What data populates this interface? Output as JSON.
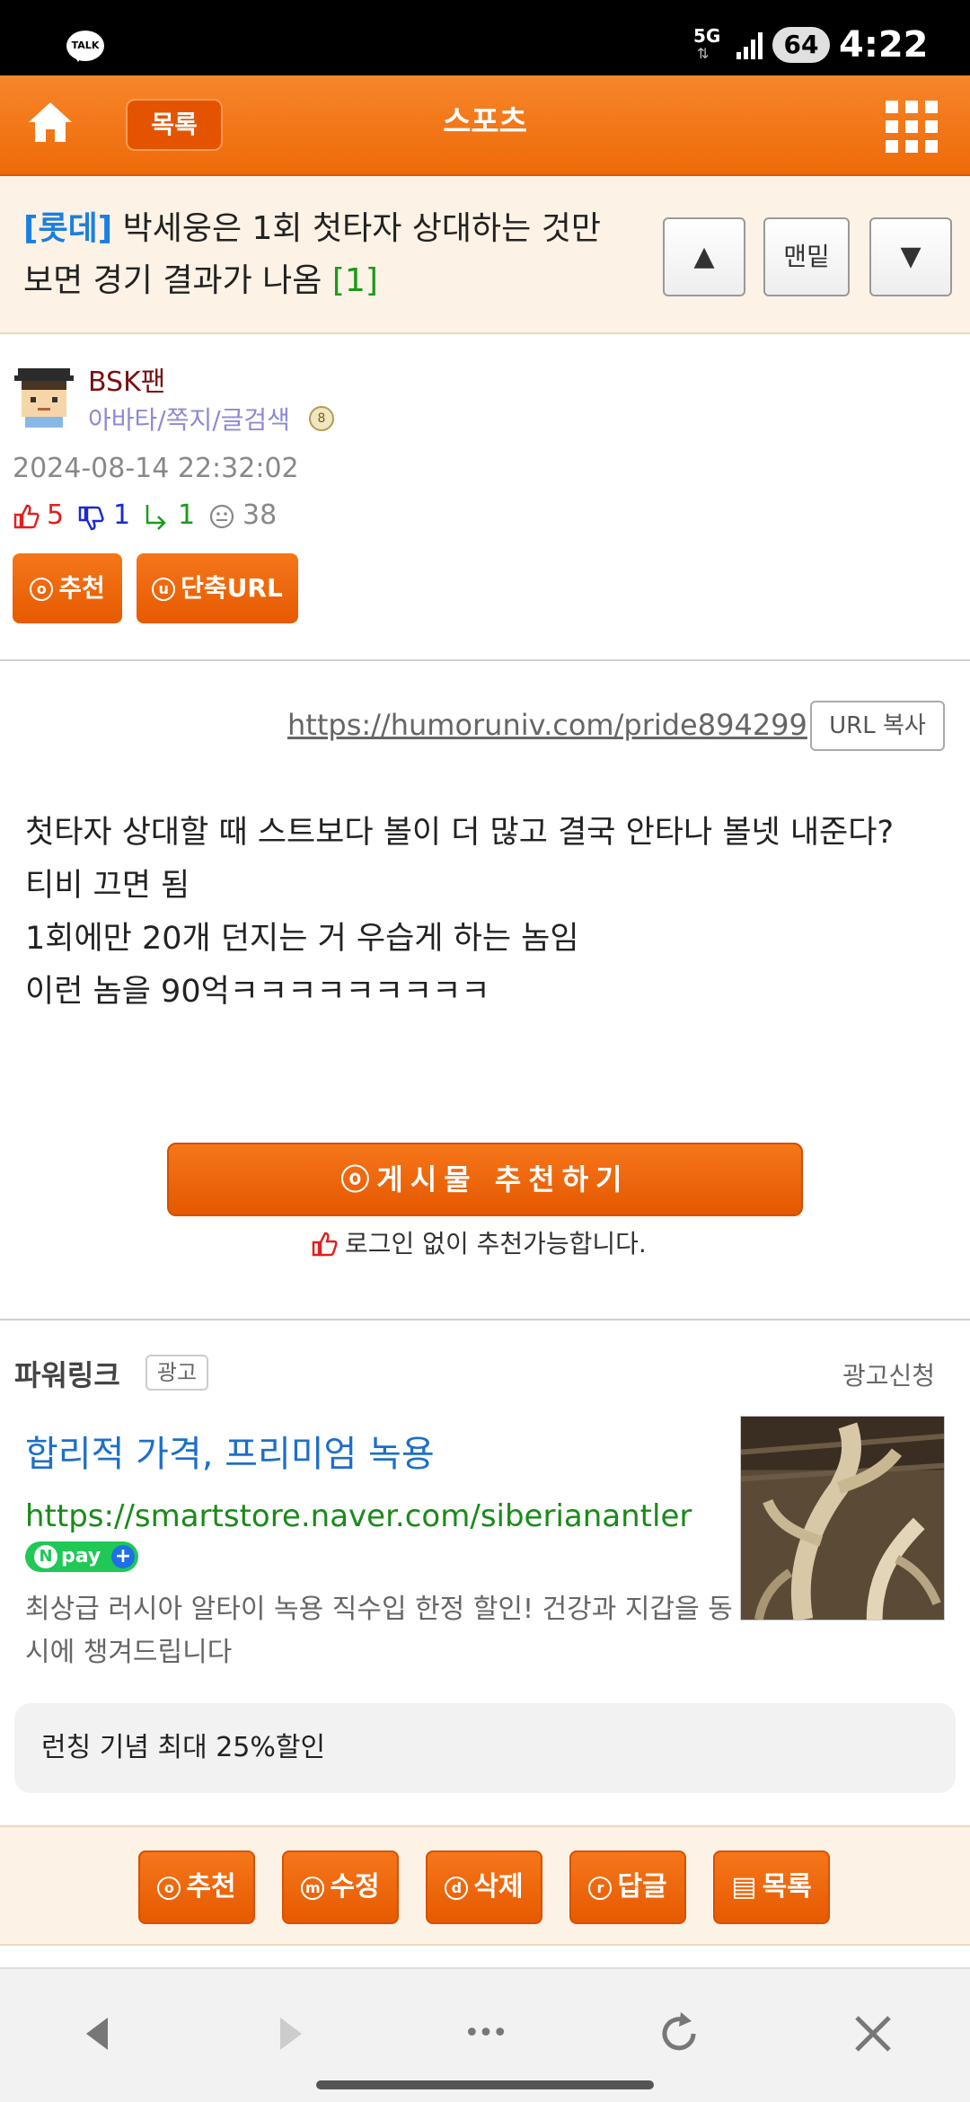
{
  "status_bar": {
    "time": "4:22",
    "battery": "64",
    "network": "5G",
    "talk_icon_label": "TALK"
  },
  "header": {
    "list_label": "목록",
    "title": "스포츠"
  },
  "post": {
    "category": "[롯데]",
    "title": "박세웅은 1회 첫타자 상대하는 것만 보면 경기 결과가 나옴",
    "comment_count": "[1]",
    "nav_up": "▲",
    "nav_bottom": "맨밑",
    "nav_down": "▼"
  },
  "author": {
    "name": "BSK팬",
    "links": "아바타/쪽지/글검색",
    "date": "2024-08-14 22:32:02"
  },
  "stats": {
    "likes": "5",
    "dislikes": "1",
    "replies": "1",
    "views": "38"
  },
  "actions": {
    "recommend_icon": "ⓞ",
    "recommend": "추천",
    "short_url_icon": "ⓤ",
    "short_url": "단축URL"
  },
  "body": {
    "source_url": "https://humoruniv.com/pride894299",
    "url_copy": "URL 복사",
    "lines": [
      "첫타자 상대할 때 스트보다 볼이 더 많고 결국 안타나 볼넷 내준다?",
      "티비 끄면 됨",
      "1회에만 20개 던지는 거 우습게 하는 놈임",
      "이런 놈을 90억ㅋㅋㅋㅋㅋㅋㅋㅋㅋ"
    ],
    "recommend_button": "ⓞ게시물 추천하기",
    "login_note": "로그인 없이 추천가능합니다."
  },
  "ad": {
    "label": "파워링크",
    "badge": "광고",
    "apply": "광고신청",
    "title": "합리적 가격, 프리미엄 녹용",
    "url": "https://smartstore.naver.com/siberianantler",
    "npay": "pay",
    "description": "최상급 러시아 알타이 녹용 직수입 한정 할인! 건강과 지갑을 동시에 챙겨드립니다",
    "promo": "런칭 기념 최대 25%할인"
  },
  "bottom_actions": [
    {
      "icon": "ⓞ",
      "label": "추천"
    },
    {
      "icon": "ⓜ",
      "label": "수정"
    },
    {
      "icon": "ⓓ",
      "label": "삭제"
    },
    {
      "icon": "ⓡ",
      "label": "답글"
    },
    {
      "icon": "▤",
      "label": "목록"
    }
  ],
  "browser_nav": {
    "more": "•••"
  },
  "colors": {
    "brand_orange": "#ee6a08",
    "category_blue": "#1b7fe0",
    "comment_green": "#1a9a1a",
    "author_red": "#7a1010"
  }
}
